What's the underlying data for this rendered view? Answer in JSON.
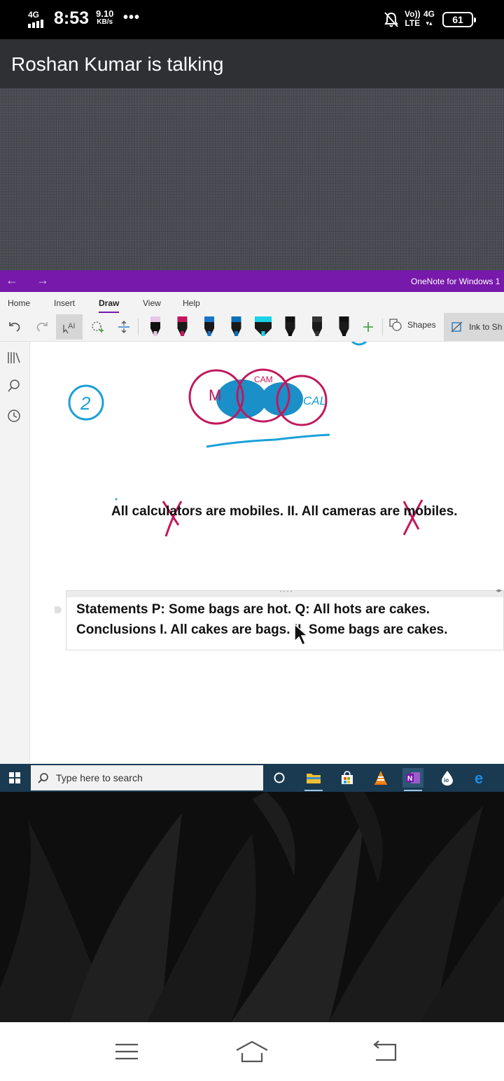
{
  "status_bar": {
    "network_label": "4G",
    "time": "8:53",
    "speed_value": "9.10",
    "speed_unit": "KB/s",
    "more": "•••",
    "volte_top": "Vo))",
    "volte_bottom": "LTE",
    "network_type": "4G",
    "battery": "61"
  },
  "call": {
    "title": "Roshan Kumar is talking"
  },
  "onenote": {
    "app_title": "OneNote for Windows 1",
    "menu_tabs": [
      "Home",
      "Insert",
      "Draw",
      "View",
      "Help"
    ],
    "active_tab": "Draw",
    "toolbar": {
      "shapes_label": "Shapes",
      "ink_to_shape_label": "Ink to Sh",
      "pen_colors": [
        "#e8c7e6",
        "#c2185b",
        "#1a73c8",
        "#0b6fb8",
        "#19d3e6",
        "#111111",
        "#333333",
        "#111111",
        "#f57c00"
      ]
    },
    "page": {
      "statement_line": "All calculators are mobiles. II. All cameras are mobiles.",
      "note_line_1": "Statements P: Some bags are hot. Q: All hots are cakes.",
      "note_line_2": "Conclusions I. All cakes are bags. II. Some bags are cakes.",
      "annotation_number": "2",
      "venn_labels": [
        "M",
        "CAM",
        "CAL"
      ]
    }
  },
  "taskbar": {
    "search_placeholder": "Type here to search",
    "apps": [
      "cortana-icon",
      "file-explorer-icon",
      "store-icon",
      "vlc-icon",
      "onenote-icon",
      "io-app-icon",
      "edge-icon"
    ]
  },
  "colors": {
    "onenote_purple": "#7719aa",
    "ink_magenta": "#c2185b",
    "ink_blue": "#1aa0d8",
    "taskbar": "#1a3a52"
  }
}
